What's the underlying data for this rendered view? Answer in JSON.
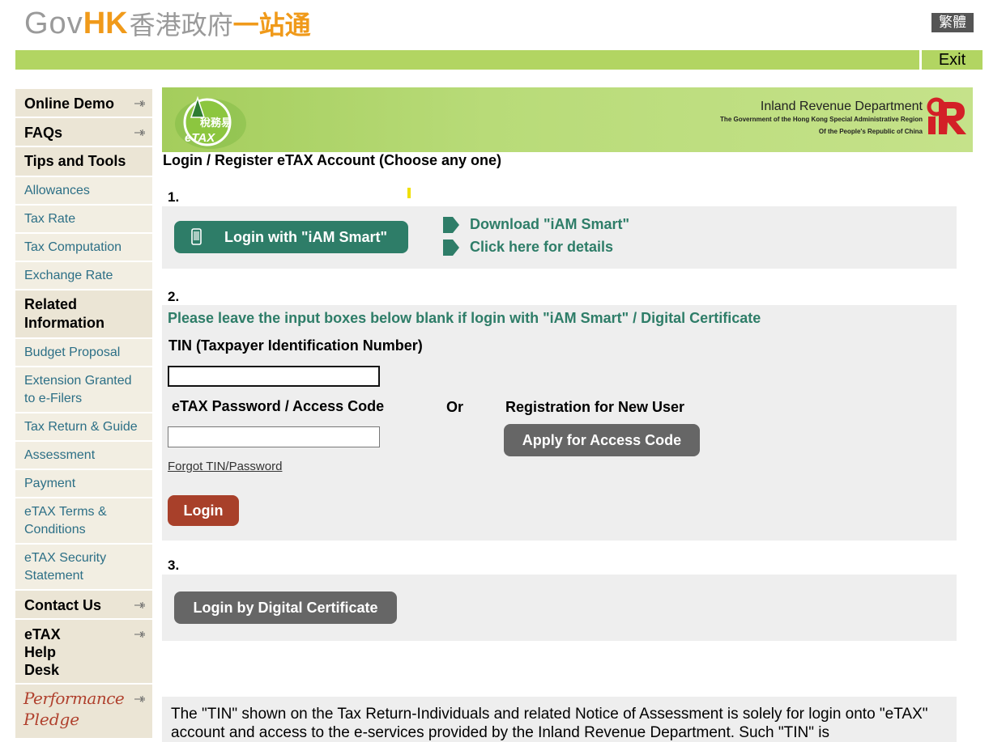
{
  "header": {
    "logo_gov": "Gov",
    "logo_hk": "HK",
    "logo_cn_grey": "香港政府",
    "logo_cn_orange": "一站通",
    "lang_toggle": "繁體",
    "exit_label": "Exit"
  },
  "sidebar": {
    "items": [
      {
        "label": "Online Demo",
        "type": "main"
      },
      {
        "label": "FAQs",
        "type": "main"
      },
      {
        "label": "Tips and Tools",
        "type": "head"
      },
      {
        "label": "Allowances",
        "type": "sub"
      },
      {
        "label": "Tax Rate",
        "type": "sub"
      },
      {
        "label": "Tax Computation",
        "type": "sub"
      },
      {
        "label": "Exchange Rate",
        "type": "sub"
      },
      {
        "label": "Related Information",
        "type": "head"
      },
      {
        "label": "Budget Proposal",
        "type": "sub"
      },
      {
        "label": "Extension Granted to e-Filers",
        "type": "sub"
      },
      {
        "label": "Tax Return & Guide",
        "type": "sub"
      },
      {
        "label": "Assessment",
        "type": "sub"
      },
      {
        "label": "Payment",
        "type": "sub"
      },
      {
        "label": "eTAX Terms & Conditions",
        "type": "sub"
      },
      {
        "label": "eTAX Security Statement",
        "type": "sub"
      },
      {
        "label": "Contact Us",
        "type": "main"
      },
      {
        "label": "eTAX Help Desk",
        "type": "main"
      }
    ],
    "pledge_line1": "Performance",
    "pledge_line2": "Pledge"
  },
  "banner": {
    "etax_cn": "稅務易",
    "etax_en": "eTAX",
    "dept_name": "Inland Revenue Department",
    "dept_line2": "The Government of the Hong Kong Special Administrative Region",
    "dept_line3": "Of the People's Republic of China",
    "ird_logo_text": "IR"
  },
  "main": {
    "heading": "Login / Register eTAX Account (Choose any one)",
    "step1": "1.",
    "iam_button": "Login with \"iAM Smart\"",
    "download_link": "Download \"iAM Smart\"",
    "details_link": "Click here for details",
    "step2": "2.",
    "hint": "Please leave the input boxes below blank if login with \"iAM Smart\" / Digital Certificate",
    "tin_label": "TIN (Taxpayer Identification Number)",
    "tin_value": "",
    "password_label": "eTAX Password / Access Code",
    "password_value": "",
    "or_label": "Or",
    "registration_label": "Registration for New User",
    "apply_button": "Apply for Access Code",
    "forgot_link": "Forgot TIN/Password",
    "login_button": "Login",
    "step3": "3.",
    "dc_button": "Login by Digital Certificate",
    "footer_note": "The \"TIN\" shown on the Tax Return-Individuals and related Notice of Assessment is solely for login onto \"eTAX\" account and access to the e-services provided by the Inland Revenue Department. Such \"TIN\" is"
  },
  "colors": {
    "green_bar": "#b2d562",
    "teal": "#2e7d68",
    "login_red": "#a8402a",
    "sidebar_bg": "#ebe5d5",
    "link_blue": "#2c6f86"
  }
}
